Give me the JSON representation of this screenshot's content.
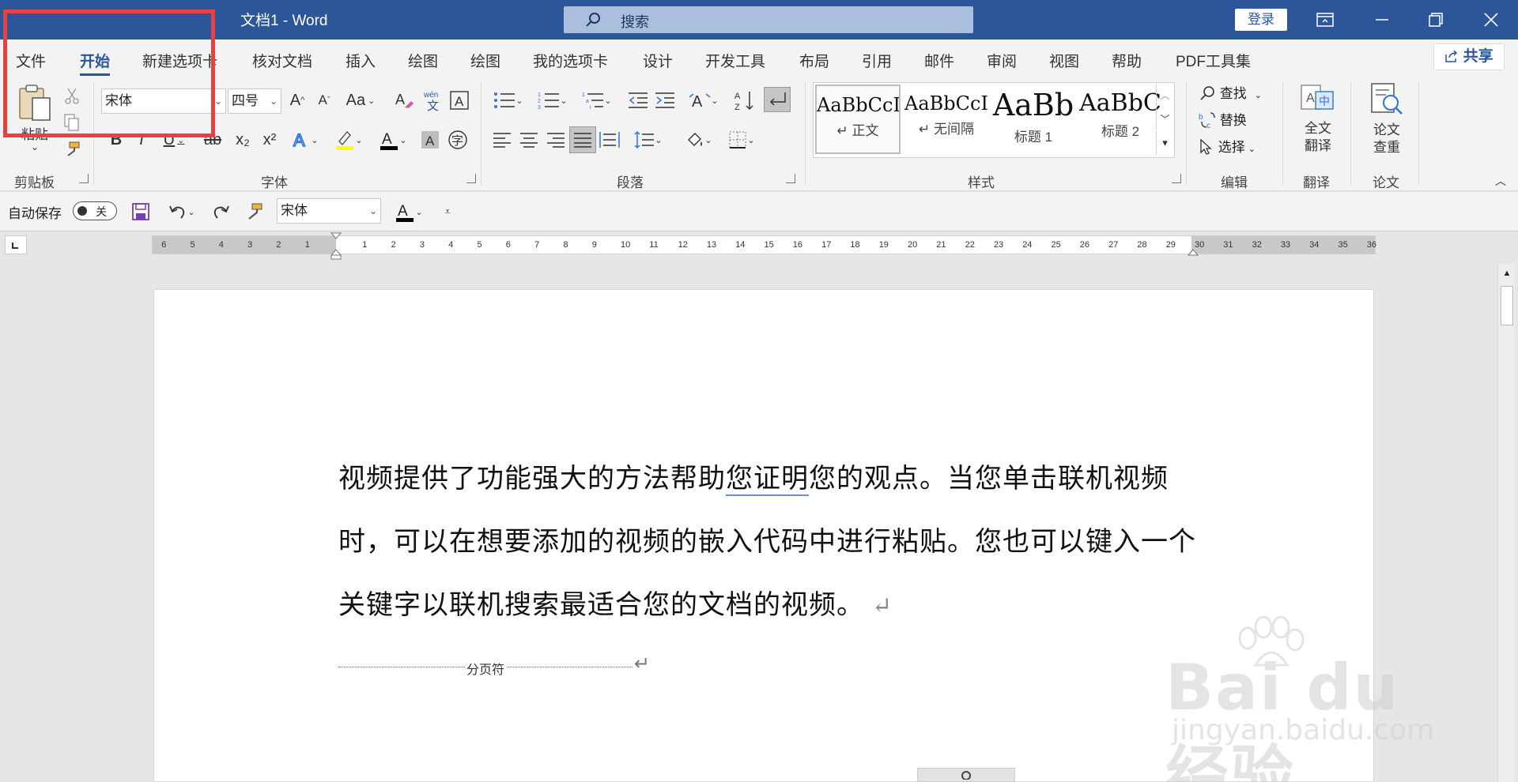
{
  "app": {
    "title": "文档1  -  Word",
    "search_placeholder": "搜索",
    "login": "登录"
  },
  "tabs": [
    "文件",
    "开始",
    "新建选项卡",
    "核对文档",
    "插入",
    "绘图",
    "绘图",
    "我的选项卡",
    "设计",
    "开发工具",
    "布局",
    "引用",
    "邮件",
    "审阅",
    "视图",
    "帮助",
    "PDF工具集"
  ],
  "share": "共享",
  "clipboard": {
    "paste": "粘贴",
    "label": "剪贴板"
  },
  "font": {
    "name": "宋体",
    "size": "四号",
    "label": "字体",
    "grow": "A",
    "shrink": "A",
    "case": "Aa",
    "bold": "B",
    "italic": "I",
    "underline": "U",
    "strike": "ab",
    "sub": "x₂",
    "sup": "x²"
  },
  "paragraph": {
    "label": "段落"
  },
  "styles": {
    "label": "样式",
    "items": [
      {
        "sample": "AaBbCcI",
        "name": "正文"
      },
      {
        "sample": "AaBbCcI",
        "name": "无间隔"
      },
      {
        "sample": "AaBb",
        "name": "标题 1"
      },
      {
        "sample": "AaBbC",
        "name": "标题 2"
      }
    ]
  },
  "editing": {
    "find": "查找",
    "replace": "替换",
    "select": "选择",
    "label": "编辑"
  },
  "translate": {
    "btn_line1": "全文",
    "btn_line2": "翻译",
    "label": "翻译"
  },
  "paper": {
    "btn_line1": "论文",
    "btn_line2": "查重",
    "label": "论文"
  },
  "qat": {
    "autosave": "自动保存",
    "toggle": "关",
    "font": "宋体"
  },
  "ruler": {
    "left": [
      "6",
      "5",
      "4",
      "3",
      "2",
      "1"
    ],
    "right": [
      "1",
      "2",
      "3",
      "4",
      "5",
      "6",
      "7",
      "8",
      "9",
      "10",
      "11",
      "12",
      "13",
      "14",
      "15",
      "16",
      "17",
      "18",
      "19",
      "20",
      "21",
      "22",
      "23",
      "24",
      "25",
      "26",
      "27",
      "28",
      "29",
      "30",
      "31",
      "32",
      "33",
      "34",
      "35",
      "36"
    ]
  },
  "document": {
    "part1": "视频提供了功能强大的方法帮助",
    "underlined": "您证明",
    "part2": "您的观点。当您单击联机视频时，可以在想要添加的视频的嵌入代码中进行粘贴。您也可以键入一个关键字以联机搜索最适合您的文档的视频。",
    "para_mark": "↵",
    "page_break": "分页符"
  },
  "watermark": {
    "line1": "Bai du 经验",
    "line2": "jingyan.baidu.com"
  },
  "colors": {
    "accent": "#2b579a",
    "highlight_box": "#e8413e",
    "font_color": "#000000",
    "highlight_color": "#ffff00"
  }
}
